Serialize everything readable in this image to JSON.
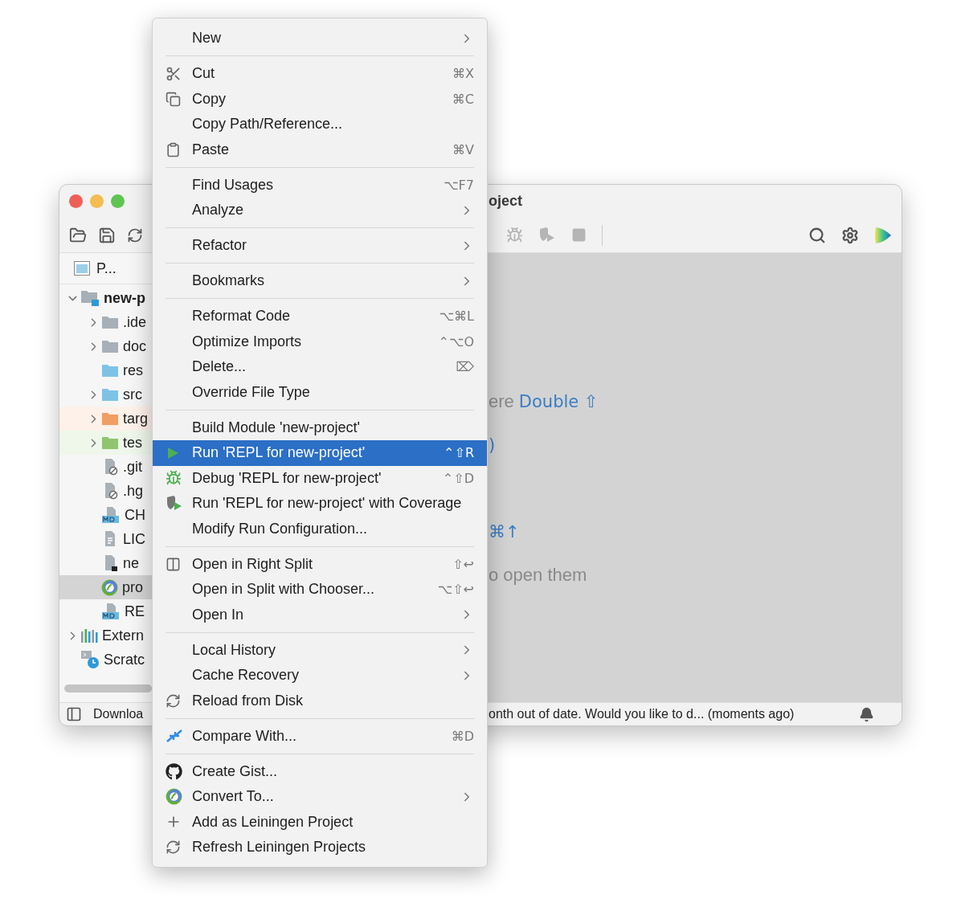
{
  "window": {
    "title": "oject",
    "project_tab": {
      "label": "P..."
    },
    "tree": [
      {
        "label": "new-p",
        "kind": "module",
        "expanded": true,
        "selected": false,
        "children": [
          {
            "label": ".ide",
            "kind": "folder",
            "color": "#a7b0b8",
            "expanded": false,
            "selected": false
          },
          {
            "label": "doc",
            "kind": "folder",
            "color": "#a7b0b8",
            "expanded": false,
            "selected": false
          },
          {
            "label": "res",
            "kind": "folder",
            "color": "#7ec3e6",
            "selected": false
          },
          {
            "label": "src",
            "kind": "folder",
            "color": "#7ec3e6",
            "expanded": false,
            "selected": false
          },
          {
            "label": "targ",
            "kind": "folder",
            "color": "#f29d62",
            "highlighted": true,
            "expanded": false,
            "selected": false
          },
          {
            "label": "tes",
            "kind": "folder",
            "color": "#8fc470",
            "highlighted": true,
            "expanded": false,
            "selected": false
          },
          {
            "label": ".git",
            "kind": "ignore",
            "selected": false
          },
          {
            "label": ".hg",
            "kind": "ignore",
            "selected": false
          },
          {
            "label": "CH",
            "kind": "markdown",
            "selected": false
          },
          {
            "label": "LIC",
            "kind": "text",
            "selected": false
          },
          {
            "label": "ne",
            "kind": "script",
            "selected": false
          },
          {
            "label": "pro",
            "kind": "clojure",
            "selected": true
          },
          {
            "label": "RE",
            "kind": "markdown",
            "selected": false
          }
        ]
      },
      {
        "label": "Extern",
        "kind": "library",
        "expanded": false,
        "selected": false
      },
      {
        "label": "Scratc",
        "kind": "scratch",
        "selected": false
      }
    ],
    "editor_hints": [
      {
        "text": "ere",
        "shortcut": "Double ⇧"
      },
      {
        "shortcut": ")"
      },
      {
        "shortcut": "⌘↑"
      },
      {
        "text": "o open them"
      }
    ],
    "status_bar": {
      "left": "Downloa",
      "message": "onth out of date. Would you like to d... (moments ago)"
    }
  },
  "menu": {
    "items": [
      {
        "kind": "item",
        "label": "New",
        "submenu": true,
        "selected": false
      },
      {
        "kind": "separator"
      },
      {
        "kind": "item",
        "label": "Cut",
        "shortcut": "⌘X",
        "submenu": false,
        "selected": false
      },
      {
        "kind": "item",
        "label": "Copy",
        "shortcut": "⌘C",
        "submenu": false,
        "selected": false
      },
      {
        "kind": "item",
        "label": "Copy Path/Reference...",
        "submenu": false,
        "selected": false
      },
      {
        "kind": "item",
        "label": "Paste",
        "shortcut": "⌘V",
        "submenu": false,
        "selected": false
      },
      {
        "kind": "separator"
      },
      {
        "kind": "item",
        "label": "Find Usages",
        "shortcut": "⌥F7",
        "submenu": false,
        "selected": false
      },
      {
        "kind": "item",
        "label": "Analyze",
        "submenu": true,
        "selected": false
      },
      {
        "kind": "separator"
      },
      {
        "kind": "item",
        "label": "Refactor",
        "submenu": true,
        "selected": false
      },
      {
        "kind": "separator"
      },
      {
        "kind": "item",
        "label": "Bookmarks",
        "submenu": true,
        "selected": false
      },
      {
        "kind": "separator"
      },
      {
        "kind": "item",
        "label": "Reformat Code",
        "shortcut": "⌥⌘L",
        "submenu": false,
        "selected": false
      },
      {
        "kind": "item",
        "label": "Optimize Imports",
        "shortcut": "⌃⌥O",
        "submenu": false,
        "selected": false
      },
      {
        "kind": "item",
        "label": "Delete...",
        "shortcut": "⌦",
        "submenu": false,
        "selected": false
      },
      {
        "kind": "item",
        "label": "Override File Type",
        "submenu": false,
        "selected": false
      },
      {
        "kind": "separator"
      },
      {
        "kind": "item",
        "label": "Build Module 'new-project'",
        "submenu": false,
        "selected": false
      },
      {
        "kind": "item",
        "label": "Run 'REPL for new-project'",
        "shortcut": "⌃⇧R",
        "submenu": false,
        "selected": true
      },
      {
        "kind": "item",
        "label": "Debug 'REPL for new-project'",
        "shortcut": "⌃⇧D",
        "submenu": false,
        "selected": false
      },
      {
        "kind": "item",
        "label": "Run 'REPL for new-project' with Coverage",
        "submenu": false,
        "selected": false
      },
      {
        "kind": "item",
        "label": "Modify Run Configuration...",
        "submenu": false,
        "selected": false
      },
      {
        "kind": "separator"
      },
      {
        "kind": "item",
        "label": "Open in Right Split",
        "shortcut": "⇧↩",
        "submenu": false,
        "selected": false
      },
      {
        "kind": "item",
        "label": "Open in Split with Chooser...",
        "shortcut": "⌥⇧↩",
        "submenu": false,
        "selected": false
      },
      {
        "kind": "item",
        "label": "Open In",
        "submenu": true,
        "selected": false
      },
      {
        "kind": "separator"
      },
      {
        "kind": "item",
        "label": "Local History",
        "submenu": true,
        "selected": false
      },
      {
        "kind": "item",
        "label": "Cache Recovery",
        "submenu": true,
        "selected": false
      },
      {
        "kind": "item",
        "label": "Reload from Disk",
        "submenu": false,
        "selected": false
      },
      {
        "kind": "separator"
      },
      {
        "kind": "item",
        "label": "Compare With...",
        "shortcut": "⌘D",
        "submenu": false,
        "selected": false
      },
      {
        "kind": "separator"
      },
      {
        "kind": "item",
        "label": "Create Gist...",
        "submenu": false,
        "selected": false
      },
      {
        "kind": "item",
        "label": "Convert To...",
        "submenu": true,
        "selected": false
      },
      {
        "kind": "item",
        "label": "Add as Leiningen Project",
        "submenu": false,
        "selected": false
      },
      {
        "kind": "item",
        "label": "Refresh Leiningen Projects",
        "submenu": false,
        "selected": false
      }
    ]
  }
}
